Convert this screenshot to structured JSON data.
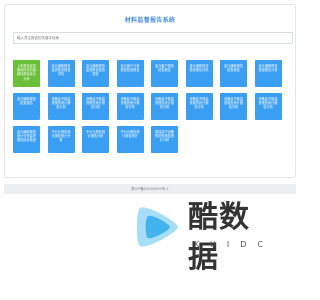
{
  "app": {
    "title": "材料监督报告系统"
  },
  "search": {
    "placeholder": "输入关注报告的关键字检索"
  },
  "tiles": [
    "上年报告监控使用情况月度超标报告综合分析",
    "金元通新报告监督检查报告详情",
    "金元通新报告监督报告检查提查",
    "金元客户分析报告检查报告",
    "金元客户报告检查报告",
    "金元通新报告检查报告详情",
    "金元通新报告检查报告",
    "金元通新报告检查报告分析",
    "金元通新报告检查报告",
    "设备监不能监督报告统计报告分析",
    "设备监不能监督报告统计报告分析",
    "设备监不能监督报告统计报告分析",
    "设备监不能监督报告统计报告分析",
    "设备监不能监督报告统计报告分析",
    "设备监不能监督报告统计报告分析",
    "设备监不能监督报告统计报告分析",
    "金元通新报告统计分析监督报告综合检查",
    "不分元报告统计报告统计分析",
    "不分元报告统计报告分析",
    "不分元报告统计报告统计",
    "提高技不设备的检查报告统计分析"
  ],
  "footer": {
    "text": "蒙ICP备00000000号-1"
  },
  "logo": {
    "name": "酷数据",
    "sub": "KUIDC"
  },
  "colors": {
    "accent": "#3a9ef2",
    "active": "#6abf38",
    "title": "#4a8ee0"
  }
}
